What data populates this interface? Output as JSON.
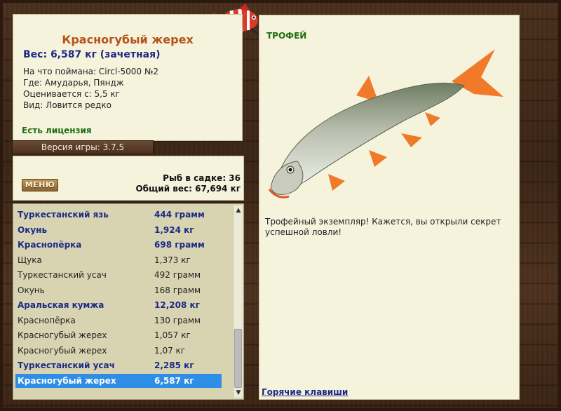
{
  "fish": {
    "title": "Красногубый жерех",
    "weight_line": "Вес: 6,587 кг (зачетная)",
    "caught_on": "На что поймана: Circl-5000 №2",
    "location": "Где: Амударья, Пяндж",
    "valued_from": "Оценивается с: 5,5 кг",
    "rarity": "Вид: Ловится редко",
    "license": "Есть лицензия"
  },
  "game_version": "Версия игры: 3.7.5",
  "keepnet": {
    "menu_label": "МЕНЮ",
    "count_line": "Рыб в садке: 36",
    "total_line": "Общий вес: 67,694 кг"
  },
  "catch_list": [
    {
      "name": "Туркестанский язь",
      "weight": "444 грамм",
      "style": "trophy"
    },
    {
      "name": "Окунь",
      "weight": "1,924 кг",
      "style": "trophy"
    },
    {
      "name": "Краснопёрка",
      "weight": "698 грамм",
      "style": "trophy"
    },
    {
      "name": "Щука",
      "weight": "1,373 кг",
      "style": "normal"
    },
    {
      "name": "Туркестанский усач",
      "weight": "492 грамм",
      "style": "normal"
    },
    {
      "name": "Окунь",
      "weight": "168 грамм",
      "style": "normal"
    },
    {
      "name": "Аральская кумжа",
      "weight": "12,208 кг",
      "style": "trophy"
    },
    {
      "name": "Краснопёрка",
      "weight": "130 грамм",
      "style": "normal"
    },
    {
      "name": "Красногубый жерех",
      "weight": "1,057 кг",
      "style": "normal"
    },
    {
      "name": "Красногубый жерех",
      "weight": "1,07 кг",
      "style": "normal"
    },
    {
      "name": "Туркестанский усач",
      "weight": "2,285 кг",
      "style": "trophy"
    },
    {
      "name": "Красногубый жерех",
      "weight": "6,587 кг",
      "style": "selected"
    }
  ],
  "trophy": {
    "label": "ТРОФЕЙ",
    "message": "Трофейный экземпляр! Кажется, вы открыли секрет успешной ловли!",
    "hotkeys_link": "Горячие клавиши"
  },
  "colors": {
    "title": "#b5541a",
    "weight": "#1d2a86",
    "license": "#1f6e13",
    "selection": "#2e8de6",
    "panel": "#f6f3dd"
  }
}
